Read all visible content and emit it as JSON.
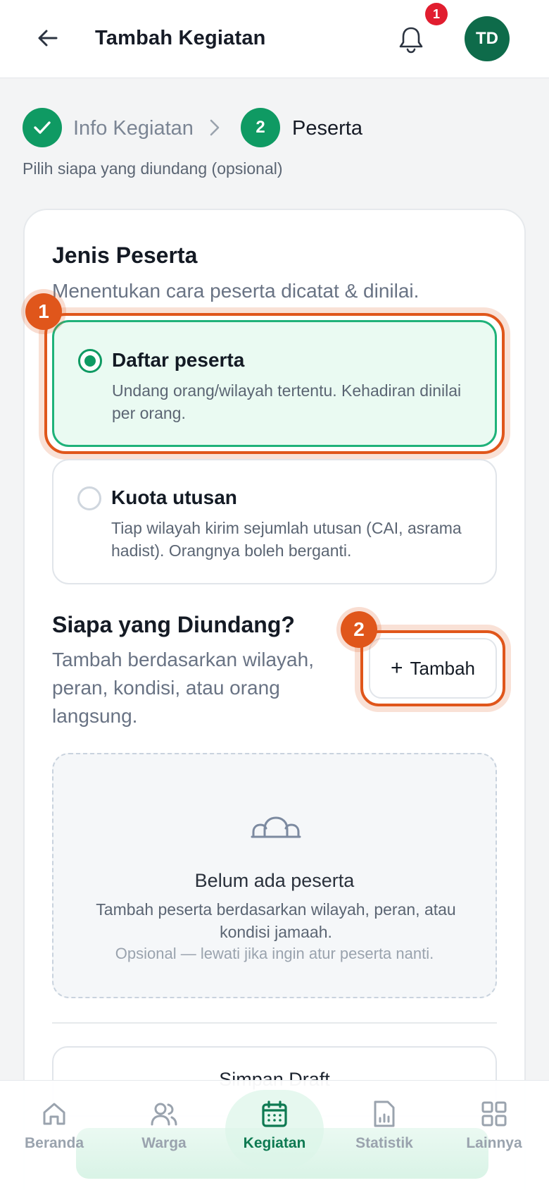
{
  "header": {
    "title": "Tambah Kegiatan",
    "notification_count": "1",
    "avatar_initials": "TD"
  },
  "stepper": {
    "step1_label": "Info Kegiatan",
    "step2_number": "2",
    "step2_label": "Peserta",
    "subtitle": "Pilih siapa yang diundang (opsional)"
  },
  "participant_type": {
    "title": "Jenis Peserta",
    "description": "Menentukan cara peserta dicatat & dinilai.",
    "options": [
      {
        "title": "Daftar peserta",
        "description": "Undang orang/wilayah tertentu. Kehadiran dinilai per orang.",
        "selected": true
      },
      {
        "title": "Kuota utusan",
        "description": "Tiap wilayah kirim sejumlah utusan (CAI, asrama hadist). Orangnya boleh berganti.",
        "selected": false
      }
    ]
  },
  "invite": {
    "title": "Siapa yang Diundang?",
    "description": "Tambah berdasarkan wilayah, peran, kondisi, atau orang langsung.",
    "add_button": "Tambah"
  },
  "empty_state": {
    "title": "Belum ada peserta",
    "description": "Tambah peserta berdasarkan wilayah, peran, atau kondisi jamaah.",
    "note": "Opsional — lewati jika ingin atur peserta nanti."
  },
  "actions": {
    "save_draft": "Simpan Draft"
  },
  "annotations": {
    "badge1": "1",
    "badge2": "2"
  },
  "bottom_nav": {
    "items": [
      {
        "label": "Beranda",
        "icon": "home-icon"
      },
      {
        "label": "Warga",
        "icon": "users-icon"
      },
      {
        "label": "Kegiatan",
        "icon": "calendar-icon",
        "active": true
      },
      {
        "label": "Statistik",
        "icon": "report-icon"
      },
      {
        "label": "Lainnya",
        "icon": "grid-icon"
      }
    ]
  },
  "colors": {
    "primary": "#0f9a63",
    "avatar": "#0e6b4a",
    "highlight": "#e0561b",
    "badge": "#e11d2f"
  }
}
